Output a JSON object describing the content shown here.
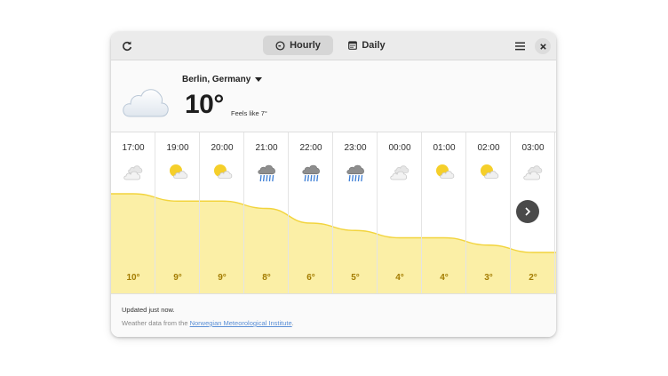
{
  "header": {
    "tabs": [
      {
        "label": "Hourly",
        "icon": "clock-icon",
        "selected": true
      },
      {
        "label": "Daily",
        "icon": "calendar-icon",
        "selected": false
      }
    ],
    "refresh_icon": "refresh-icon",
    "menu_icon": "hamburger-menu-icon",
    "close_icon": "close-icon"
  },
  "current": {
    "location": "Berlin, Germany",
    "temperature": "10°",
    "feels_like": "Feels like 7°",
    "condition_icon": "cloud-icon"
  },
  "hourly": [
    {
      "time": "17:00",
      "temp": "10°",
      "value": 10,
      "icon": "partly-cloudy-grey"
    },
    {
      "time": "19:00",
      "temp": "9°",
      "value": 9,
      "icon": "sun-cloud"
    },
    {
      "time": "20:00",
      "temp": "9°",
      "value": 9,
      "icon": "sun-cloud"
    },
    {
      "time": "21:00",
      "temp": "8°",
      "value": 8,
      "icon": "rain"
    },
    {
      "time": "22:00",
      "temp": "6°",
      "value": 6,
      "icon": "rain"
    },
    {
      "time": "23:00",
      "temp": "5°",
      "value": 5,
      "icon": "rain"
    },
    {
      "time": "00:00",
      "temp": "4°",
      "value": 4,
      "icon": "partly-cloudy-grey"
    },
    {
      "time": "01:00",
      "temp": "4°",
      "value": 4,
      "icon": "sun-cloud"
    },
    {
      "time": "02:00",
      "temp": "3°",
      "value": 3,
      "icon": "sun-cloud"
    },
    {
      "time": "03:00",
      "temp": "2°",
      "value": 2,
      "icon": "partly-cloudy-grey"
    }
  ],
  "footer": {
    "updated": "Updated just now.",
    "source_prefix": "Weather data from the ",
    "source_link": "Norwegian Meteorological Institute",
    "source_suffix": "."
  },
  "colors": {
    "accent_fill": "#fbefa6",
    "accent_line": "#f2d43d",
    "temp_text": "#a37c00"
  }
}
